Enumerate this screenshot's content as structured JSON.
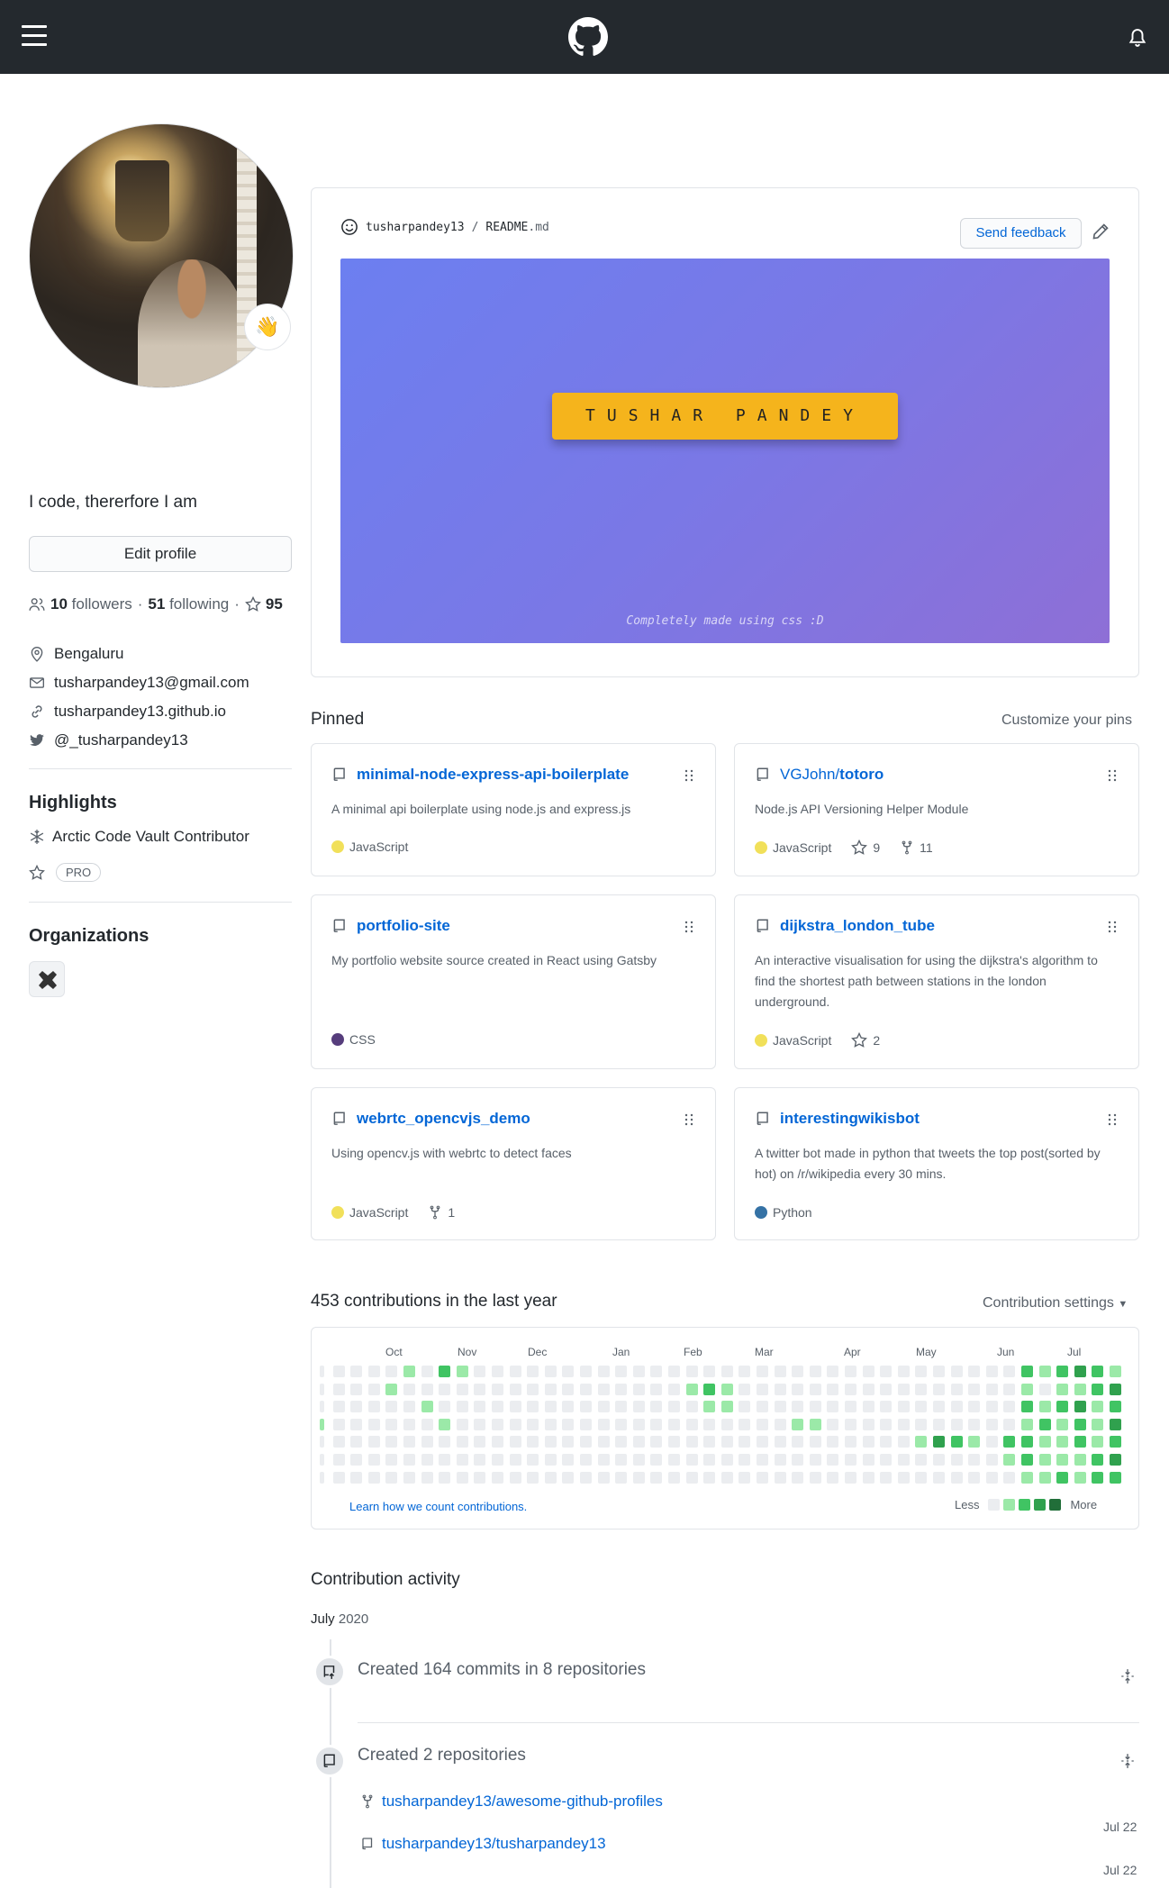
{
  "profile": {
    "bio": "I code, thererfore I am",
    "status_emoji": "👋",
    "edit_label": "Edit profile",
    "followers_count": "10",
    "followers_label": "followers",
    "following_count": "51",
    "following_label": "following",
    "separator": "·",
    "stars_count": "95",
    "location": "Bengaluru",
    "email": "tusharpandey13@gmail.com",
    "website": "tusharpandey13.github.io",
    "twitter": "@_tusharpandey13"
  },
  "highlights": {
    "title": "Highlights",
    "items": [
      "Arctic Code Vault Contributor"
    ],
    "pro_label": "PRO"
  },
  "organizations": {
    "title": "Organizations"
  },
  "readme": {
    "owner": "tusharpandey13",
    "slash": "/",
    "file": "README",
    "ext": ".md",
    "feedback_label": "Send feedback",
    "banner_title": "TUSHAR PANDEY",
    "banner_footer": "Completely made using css :D"
  },
  "pinned": {
    "title": "Pinned",
    "customize_label": "Customize your pins",
    "repos": [
      {
        "owner": "",
        "name": "minimal-node-express-api-boilerplate",
        "desc": "A minimal api boilerplate using node.js and express.js",
        "lang": "JavaScript",
        "lang_color": "#f1e05a",
        "stars": "",
        "forks": ""
      },
      {
        "owner": "VGJohn/",
        "name": "totoro",
        "desc": "Node.js API Versioning Helper Module",
        "lang": "JavaScript",
        "lang_color": "#f1e05a",
        "stars": "9",
        "forks": "11"
      },
      {
        "owner": "",
        "name": "portfolio-site",
        "desc": "My portfolio website source created in React using Gatsby",
        "lang": "CSS",
        "lang_color": "#563d7c",
        "stars": "",
        "forks": ""
      },
      {
        "owner": "",
        "name": "dijkstra_london_tube",
        "desc": "An interactive visualisation for using the dijkstra's algorithm to find the shortest path between stations in the london underground.",
        "lang": "JavaScript",
        "lang_color": "#f1e05a",
        "stars": "2",
        "forks": ""
      },
      {
        "owner": "",
        "name": "webrtc_opencvjs_demo",
        "desc": "Using opencv.js with webrtc to detect faces",
        "lang": "JavaScript",
        "lang_color": "#f1e05a",
        "stars": "",
        "forks": "1"
      },
      {
        "owner": "",
        "name": "interestingwikisbot",
        "desc": "A twitter bot made in python that tweets the top post(sorted by hot) on /r/wikipedia every 30 mins.",
        "lang": "Python",
        "lang_color": "#3572A5",
        "stars": "",
        "forks": ""
      }
    ]
  },
  "contributions": {
    "title": "453 contributions in the last year",
    "settings_label": "Contribution settings",
    "months": [
      "Oct",
      "Nov",
      "Dec",
      "Jan",
      "Feb",
      "Mar",
      "Apr",
      "May",
      "Jun",
      "Jul"
    ],
    "learn_label": "Learn how we count contributions.",
    "legend_less": "Less",
    "legend_more": "More",
    "level_colors": [
      "#ebedf0",
      "#9be9a8",
      "#40c463",
      "#30a14e",
      "#216e39"
    ]
  },
  "activity": {
    "title": "Contribution activity",
    "month": "July",
    "year": "2020",
    "commits_text": "Created 164 commits in 8 repositories",
    "repos_text": "Created 2 repositories",
    "created_repos": [
      {
        "name": "tusharpandey13/awesome-github-profiles",
        "date": "Jul 22"
      },
      {
        "name": "tusharpandey13/tusharpandey13",
        "date": "Jul 22"
      }
    ]
  }
}
